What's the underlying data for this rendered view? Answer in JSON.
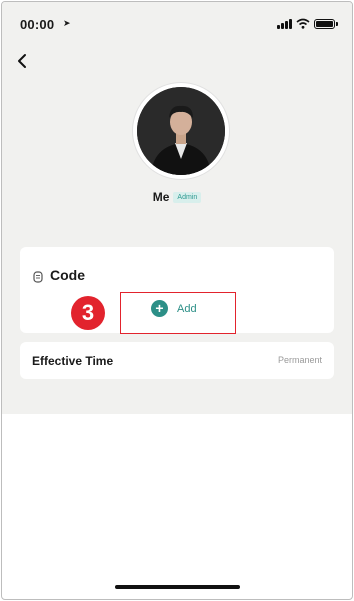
{
  "status_bar": {
    "time": "00:00",
    "location_icon": "location-arrow-icon"
  },
  "nav": {
    "back_icon": "chevron-left-icon"
  },
  "profile": {
    "name": "Me",
    "role_badge": "Admin"
  },
  "code_section": {
    "title": "Code",
    "add_label": "Add"
  },
  "effective_time": {
    "label": "Effective Time",
    "value": "Permanent"
  },
  "annotation": {
    "step_number": "3"
  },
  "colors": {
    "accent": "#2c8f87",
    "annotation_red": "#e2232d",
    "background": "#f1f1ef"
  }
}
